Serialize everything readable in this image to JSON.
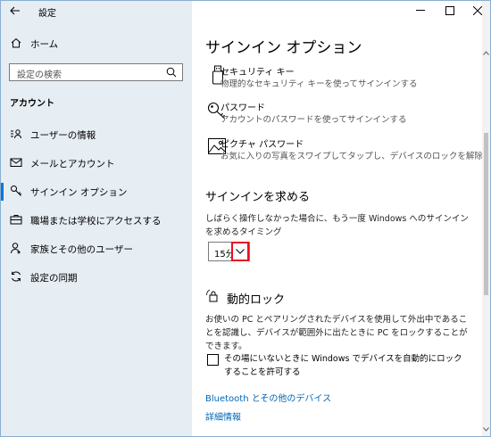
{
  "titlebar": {
    "title": "設定"
  },
  "sidebar": {
    "home_label": "ホーム",
    "search_placeholder": "設定の検索",
    "section_heading": "アカウント",
    "items": [
      {
        "label": "ユーザーの情報",
        "icon": "user-info-icon"
      },
      {
        "label": "メールとアカウント",
        "icon": "mail-icon"
      },
      {
        "label": "サインイン オプション",
        "icon": "key-icon",
        "selected": true
      },
      {
        "label": "職場または学校にアクセスする",
        "icon": "briefcase-icon"
      },
      {
        "label": "家族とその他のユーザー",
        "icon": "people-icon"
      },
      {
        "label": "設定の同期",
        "icon": "sync-icon"
      }
    ]
  },
  "main": {
    "title": "サインイン オプション",
    "options": [
      {
        "title": "セキュリティ キー",
        "desc": "物理的なセキュリティ キーを使ってサインインする",
        "icon": "usb-key-icon"
      },
      {
        "title": "パスワード",
        "desc": "アカウントのパスワードを使ってサインインする",
        "icon": "password-key-icon"
      },
      {
        "title": "ピクチャ パスワード",
        "desc": "お気に入りの写真をスワイプしてタップし、デバイスのロックを解除する",
        "icon": "picture-icon"
      }
    ],
    "require_signin": {
      "heading": "サインインを求める",
      "description": "しばらく操作しなかった場合に、もう一度 Windows へのサインインを求めるタイミング",
      "dropdown_value": "15分"
    },
    "dynamic_lock": {
      "heading": "動的ロック",
      "description": "お使いの PC とペアリングされたデバイスを使用して外出中であることを認識し、デバイスが範囲外に出たときに PC をロックすることができます。",
      "checkbox_label": "その場にいないときに Windows でデバイスを自動的にロックすることを許可する",
      "checked": false
    },
    "links": {
      "bluetooth": "Bluetooth とその他のデバイス",
      "details": "詳細情報"
    }
  },
  "colors": {
    "accent": "#0078d7",
    "sidebar_bg": "#e6edf3",
    "highlight": "#e81123",
    "link": "#0067b8"
  }
}
